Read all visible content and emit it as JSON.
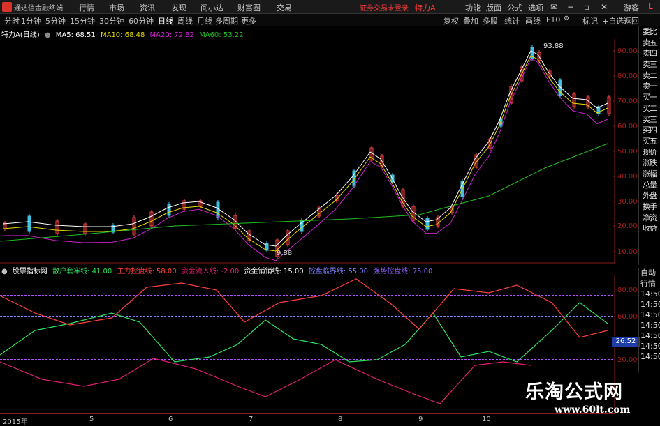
{
  "titlebar": {
    "app_title": "通达信金融终端",
    "menus": [
      "行情",
      "市场",
      "资讯",
      "发现",
      "问小达",
      "财富圈",
      "交易"
    ],
    "notice": "证券交易未登录",
    "stock_name": "特力A",
    "right_menus": [
      "功能",
      "版面",
      "公式",
      "选项"
    ],
    "guest": "游客",
    "corner": "L"
  },
  "periodbar": {
    "periods": [
      "分时",
      "1分钟",
      "5分钟",
      "15分钟",
      "30分钟",
      "60分钟",
      "日线",
      "周线",
      "月线",
      "多周期",
      "更多"
    ],
    "active_period": "日线",
    "tools": [
      "复权",
      "叠加",
      "多股",
      "统计",
      "画线",
      "F10",
      "标记",
      "+自选",
      "返回"
    ]
  },
  "main_chart": {
    "title": "特力A(日线)",
    "ma": [
      {
        "label": "MA5: 68.51",
        "color": "#ffffff"
      },
      {
        "label": "MA10: 68.48",
        "color": "#e8d800"
      },
      {
        "label": "MA20: 72.82",
        "color": "#d020d0"
      },
      {
        "label": "MA60: 53.22",
        "color": "#20c020"
      }
    ],
    "high_label": "93.88",
    "low_label": "9.88",
    "y_ticks": [
      "90.00",
      "80.00",
      "70.00",
      "60.00",
      "50.00",
      "40.00",
      "30.00",
      "20.00",
      "10.00"
    ]
  },
  "indicator": {
    "title": "股票指标网",
    "lines": [
      {
        "label": "散户套牢线: 41.00",
        "color": "#30e060"
      },
      {
        "label": "主力控盘线: 58.00",
        "color": "#ff4040"
      },
      {
        "label": "资金流入线: -2.00",
        "color": "#e02070"
      },
      {
        "label": "资金铺销线: 15.00",
        "color": "#ffffff"
      },
      {
        "label": "控盘临界线: 55.00",
        "color": "#8080ff"
      },
      {
        "label": "强势控盘线: 75.00",
        "color": "#9060ff"
      }
    ],
    "y_ticks": [
      "80.00",
      "60.00",
      "40.00",
      "20.00"
    ],
    "current_value": "26.52"
  },
  "order_book_labels": [
    "委比",
    "卖五",
    "卖四",
    "卖三",
    "卖二",
    "卖一",
    "买一",
    "买二",
    "买三",
    "买四",
    "买五",
    "现价",
    "涨跌",
    "涨幅",
    "总量",
    "外盘",
    "换手",
    "净资",
    "收益"
  ],
  "sidebar2": {
    "tabs": [
      "自动",
      "行情"
    ],
    "times": [
      "14:50",
      "14:50",
      "14:50",
      "14:50",
      "14:50",
      "14:50",
      "14:50"
    ]
  },
  "x_axis": [
    "2015年",
    "5",
    "6",
    "7",
    "8",
    "9",
    "10"
  ],
  "watermark": {
    "line1": "乐淘公式网",
    "line2": "www.60lt.com"
  }
}
